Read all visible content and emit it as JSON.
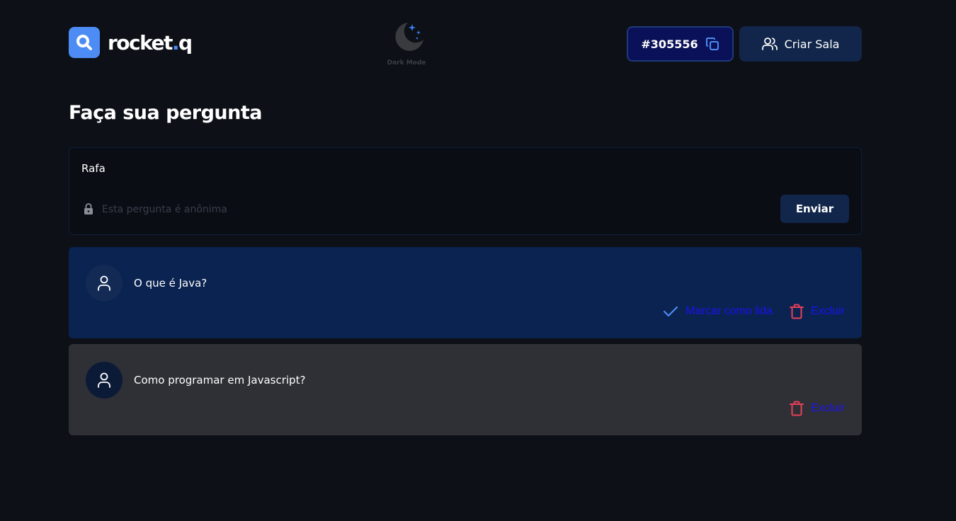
{
  "header": {
    "logo_text": "rocket",
    "logo_dot": ".",
    "logo_suffix": "q",
    "dark_mode_label": "Dark Mode",
    "room_code": "#305556",
    "create_room_label": "Criar Sala"
  },
  "title": "Faça sua pergunta",
  "form": {
    "value": "Rafa",
    "anonymous_label": "Esta pergunta é anônima",
    "send_label": "Enviar"
  },
  "questions": [
    {
      "text": "O que é Java?",
      "mark_read_label": "Marcar como lida",
      "delete_label": "Excluir"
    },
    {
      "text": "Como programar em Javascript?",
      "delete_label": "Excluir"
    }
  ],
  "colors": {
    "background": "#0d1017",
    "accent": "#4d8cf5",
    "question_highlight": "#0b2350",
    "question_read": "#2f3036",
    "delete_icon": "#e83f5b",
    "action_text": "#1b12f0"
  }
}
